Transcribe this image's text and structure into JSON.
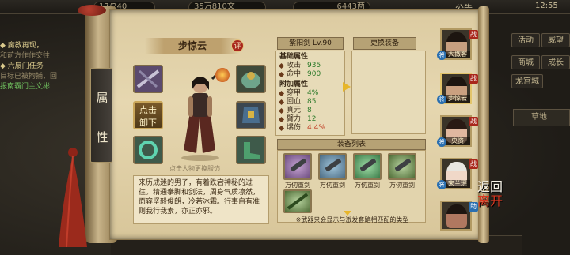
{
  "top": {
    "stamina": "17/240",
    "copper": "35万810文",
    "silver": "6443两",
    "announce": "公告",
    "time": "12:55"
  },
  "quests": {
    "items": [
      {
        "title": "◆ 魔教再现，",
        "desc": "和前方作作交往"
      },
      {
        "title": "◆ 六扇门任务",
        "desc": "目标已被拘捕，回",
        "desc2": "报南霸门主文彬"
      }
    ]
  },
  "right_menu": [
    "活动",
    "威望",
    "商城",
    "成长",
    "龙宫城"
  ],
  "right_list": "草地",
  "scroll": {
    "side_tab": [
      "属",
      "性"
    ]
  },
  "hero": {
    "name": "步惊云",
    "review": "评",
    "unequip_label": [
      "点击",
      "卸下"
    ],
    "hint": "点击人物更换服饰",
    "bio": "来历成迷的男子，有着跌宕神秘的过往。精通拳脚和剑法，周身气质凛然，面容坚毅俊朗，冷若冰霜。行事自有准则我行我素，亦正亦邪。"
  },
  "weapon": {
    "title": "紫阳剑 Lv.90",
    "base_title": "基础属性",
    "base": [
      {
        "name": "攻击",
        "value": "935"
      },
      {
        "name": "命中",
        "value": "900"
      }
    ],
    "extra_title": "附加属性",
    "extra": [
      {
        "name": "穿甲",
        "value": "4%"
      },
      {
        "name": "回血",
        "value": "85"
      },
      {
        "name": "真元",
        "value": "8"
      },
      {
        "name": "臂力",
        "value": "12"
      },
      {
        "name": "爆伤",
        "value": "4.4%"
      }
    ]
  },
  "change_equip_title": "更换装备",
  "equip_list": {
    "title": "装备列表",
    "items": [
      {
        "label": "万仞重剑"
      },
      {
        "label": "万仞重剑"
      },
      {
        "label": "万仞重剑"
      },
      {
        "label": "万仞重剑"
      }
    ],
    "bottom_item": "",
    "warning": "※武器只会显示与激发套路相匹配的类型"
  },
  "roster": [
    {
      "name": "大撒客",
      "tag": "战",
      "side": "将"
    },
    {
      "name": "步惊云",
      "tag": "战",
      "side": "将"
    },
    {
      "name": "央资",
      "tag": "战",
      "side": "将"
    },
    {
      "name": "宋兰瑶",
      "tag": "战",
      "side": "将"
    },
    {
      "name": "",
      "tag": "助",
      "side": "将"
    }
  ],
  "return_label": [
    "返",
    "回"
  ],
  "return_label2": [
    "离",
    "开"
  ],
  "colors": {
    "paper": "#e6d7b0",
    "accent_red": "#a9271c",
    "gold": "#e7b62a",
    "green_value": "#2c7a2a"
  }
}
